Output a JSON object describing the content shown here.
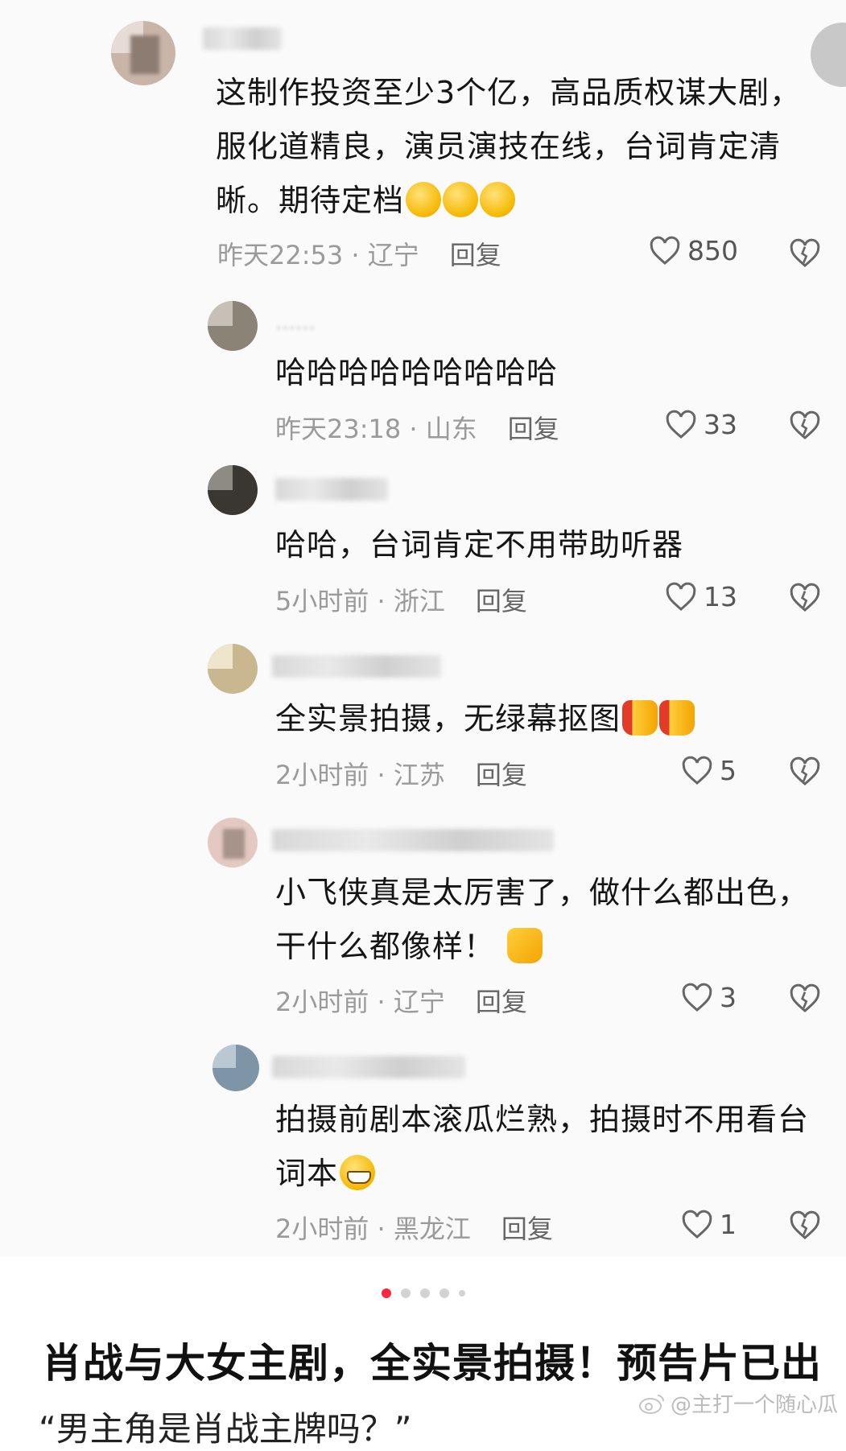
{
  "comments": [
    {
      "lines": [
        "这制作投资至少3个亿，高品质权谋大剧，",
        "服化道精良，演员演技在线，台词肯定清",
        "晰。期待定档"
      ],
      "emojis": [
        "clap-emoji",
        "clap-emoji",
        "clap-emoji"
      ],
      "time": "昨天22:53",
      "location": "辽宁",
      "reply": "回复",
      "likes": "850"
    },
    {
      "name": "......",
      "lines": [
        "哈哈哈哈哈哈哈哈哈"
      ],
      "time": "昨天23:18",
      "location": "山东",
      "reply": "回复",
      "likes": "33"
    },
    {
      "lines": [
        "哈哈，台词肯定不用带助听器"
      ],
      "time": "5小时前",
      "location": "浙江",
      "reply": "回复",
      "likes": "13"
    },
    {
      "lines": [
        "全实景拍摄，无绿幕抠图"
      ],
      "emojis": [
        "thumbs-up-emoji",
        "thumbs-up-emoji"
      ],
      "time": "2小时前",
      "location": "江苏",
      "reply": "回复",
      "likes": "5"
    },
    {
      "lines": [
        "小飞侠真是太厉害了，做什么都出色，",
        "干什么都像样！"
      ],
      "emojis": [
        "thumbs-up-emoji"
      ],
      "time": "2小时前",
      "location": "辽宁",
      "reply": "回复",
      "likes": "3"
    },
    {
      "lines": [
        "拍摄前剧本滚瓜烂熟，拍摄时不用看台",
        "词本"
      ],
      "emojis": [
        "grin-emoji"
      ],
      "time": "2小时前",
      "location": "黑龙江",
      "reply": "回复",
      "likes": "1"
    }
  ],
  "separator": " · ",
  "pagination": {
    "total": 5,
    "active": 1
  },
  "headline": "肖战与大女主剧，全实景拍摄！预告片已出",
  "subline": "“男主角是肖战主牌吗？”",
  "watermark": "@主打一个随心瓜",
  "colors": {
    "accent": "#ff2442",
    "meta": "#9a9a9a",
    "text": "#151515"
  }
}
